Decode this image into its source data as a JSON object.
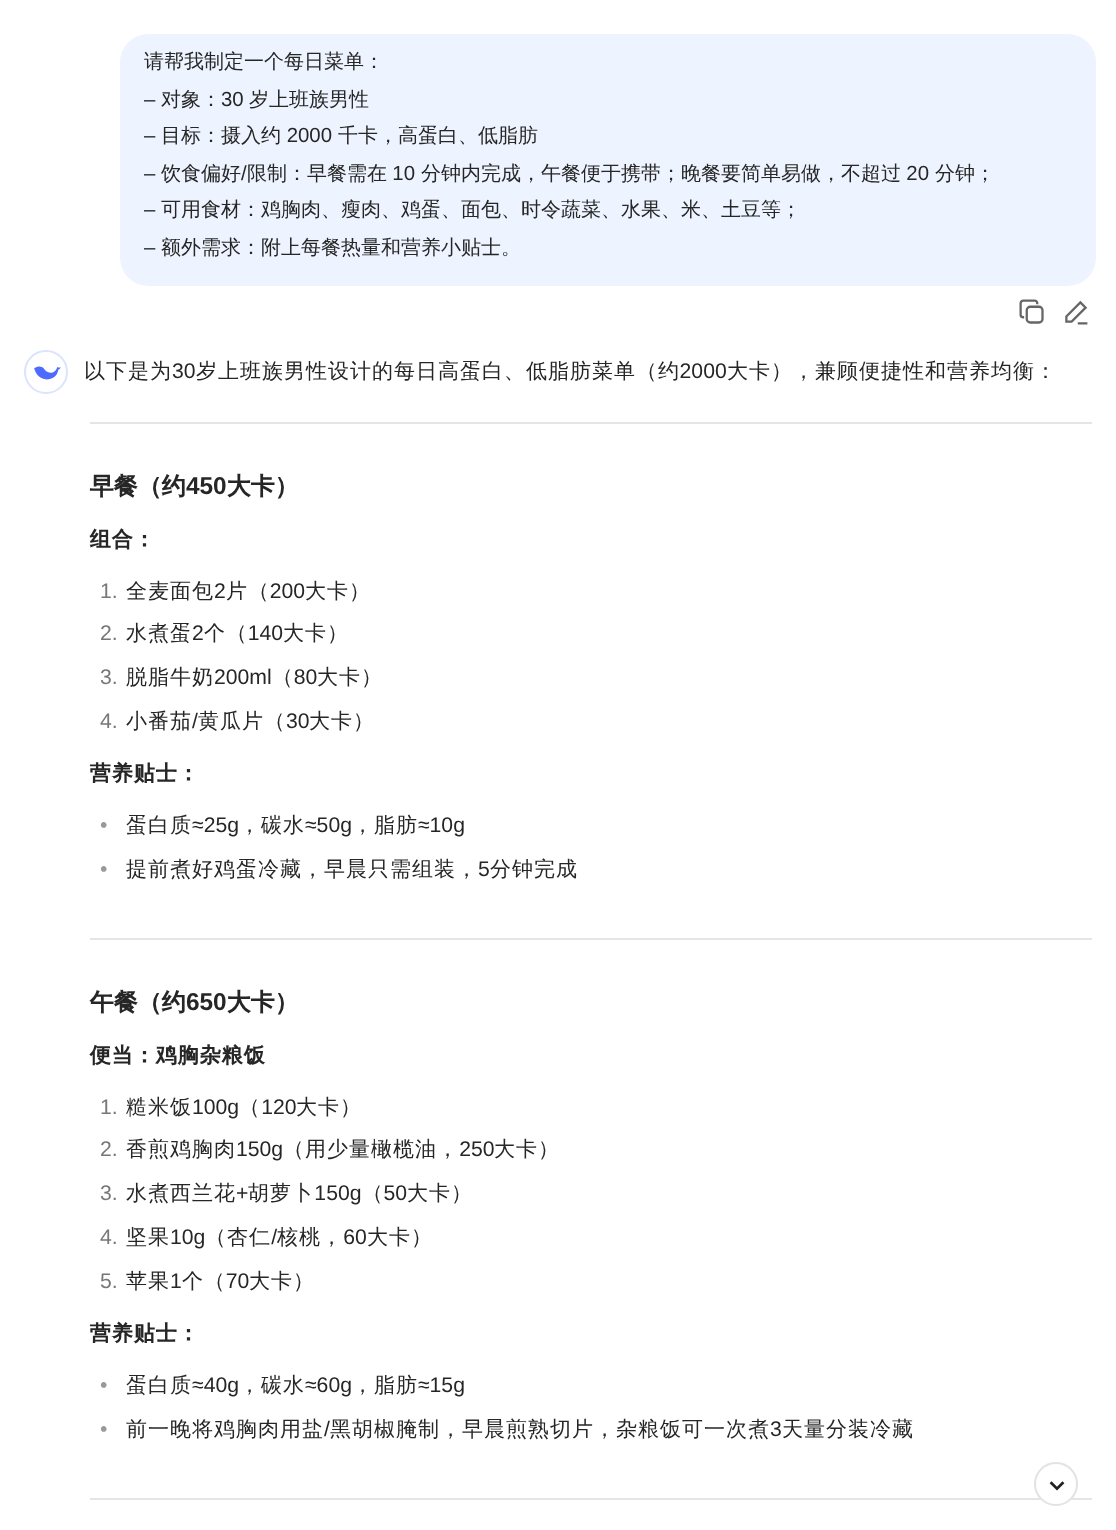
{
  "user_message": {
    "lines": [
      "请帮我制定一个每日菜单：",
      "– 对象：30 岁上班族男性",
      "– 目标：摄入约 2000 千卡，高蛋白、低脂肪",
      "– 饮食偏好/限制：早餐需在 10 分钟内完成，午餐便于携带；晚餐要简单易做，不超过 20 分钟；",
      "– 可用食材：鸡胸肉、瘦肉、鸡蛋、面包、时令蔬菜、水果、米、土豆等；",
      "– 额外需求：附上每餐热量和营养小贴士。"
    ]
  },
  "reply": {
    "intro": "以下是为30岁上班族男性设计的每日高蛋白、低脂肪菜单（约2000大卡），兼顾便捷性和营养均衡：",
    "sections": [
      {
        "title": "早餐（约450大卡）",
        "subtitle": "组合：",
        "items": [
          {
            "marker": "1.",
            "text": "全麦面包2片（200大卡）"
          },
          {
            "marker": "2.",
            "text": "水煮蛋2个（140大卡）"
          },
          {
            "marker": "3.",
            "text": "脱脂牛奶200ml（80大卡）"
          },
          {
            "marker": "4.",
            "text": "小番茄/黄瓜片（30大卡）"
          }
        ],
        "tips_label": "营养贴士：",
        "tips": [
          {
            "marker": "•",
            "text": "蛋白质≈25g，碳水≈50g，脂肪≈10g"
          },
          {
            "marker": "•",
            "text": "提前煮好鸡蛋冷藏，早晨只需组装，5分钟完成"
          }
        ]
      },
      {
        "title": "午餐（约650大卡）",
        "subtitle": "便当：鸡胸杂粮饭",
        "items": [
          {
            "marker": "1.",
            "text": "糙米饭100g（120大卡）"
          },
          {
            "marker": "2.",
            "text": "香煎鸡胸肉150g（用少量橄榄油，250大卡）"
          },
          {
            "marker": "3.",
            "text": "水煮西兰花+胡萝卜150g（50大卡）"
          },
          {
            "marker": "4.",
            "text": "坚果10g（杏仁/核桃，60大卡）"
          },
          {
            "marker": "5.",
            "text": "苹果1个（70大卡）"
          }
        ],
        "tips_label": "营养贴士：",
        "tips": [
          {
            "marker": "•",
            "text": "蛋白质≈40g，碳水≈60g，脂肪≈15g"
          },
          {
            "marker": "•",
            "text": "前一晚将鸡胸肉用盐/黑胡椒腌制，早晨煎熟切片，杂粮饭可一次煮3天量分装冷藏"
          }
        ]
      }
    ]
  }
}
